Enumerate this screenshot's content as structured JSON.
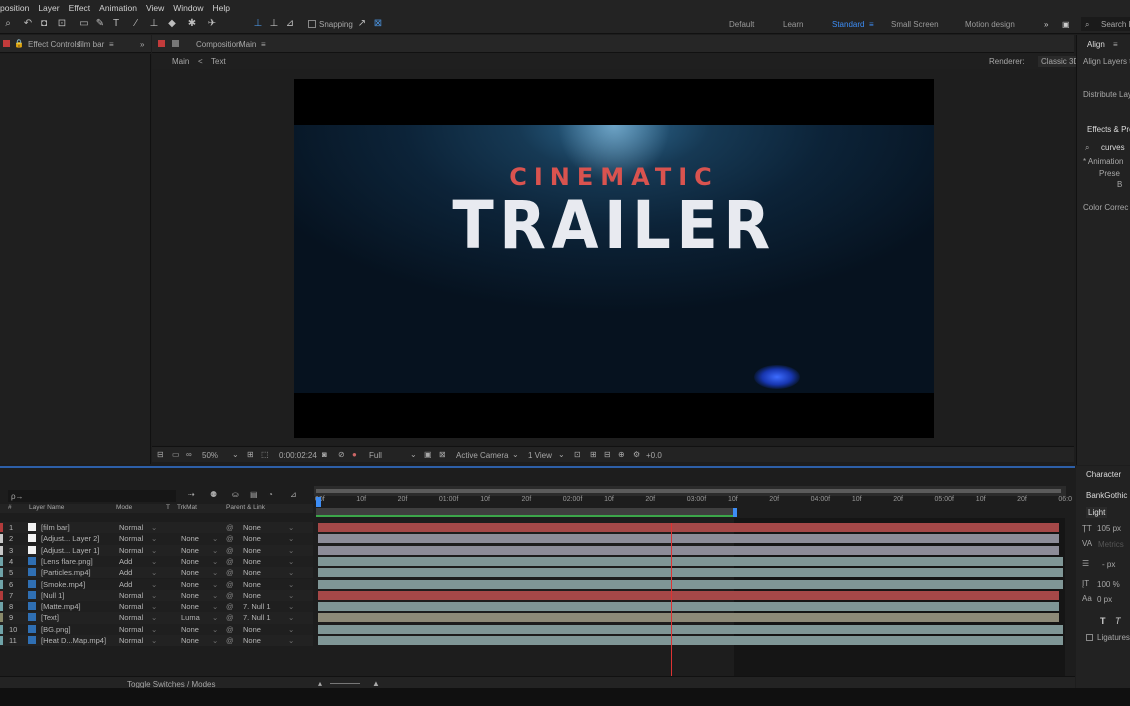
{
  "menu": [
    "position",
    "Layer",
    "Effect",
    "Animation",
    "View",
    "Window",
    "Help"
  ],
  "toolbar": {
    "snapping": "Snapping"
  },
  "workspaces": [
    {
      "label": "Default",
      "active": false
    },
    {
      "label": "Learn",
      "active": false
    },
    {
      "label": "Standard",
      "active": true
    },
    {
      "label": "Small Screen",
      "active": false
    },
    {
      "label": "Motion design",
      "active": false
    }
  ],
  "search_label": "Search H",
  "effect_controls": {
    "title": "Effect Controls",
    "layer": "film bar"
  },
  "composition": {
    "title": "Composition",
    "name": "Main",
    "tabs": [
      "Main",
      "Text"
    ],
    "renderer_label": "Renderer:",
    "renderer": "Classic 3D"
  },
  "right_panels": {
    "align": "Align",
    "align_layers": "Align Layers to",
    "distribute": "Distribute Laye",
    "effects_presets": "Effects & Pres",
    "search": "curves",
    "tree": [
      "* Animation",
      "Prese",
      "B",
      "Color Correc"
    ]
  },
  "preview": {
    "line1": "CINEMATIC",
    "line2": "TRAILER"
  },
  "viewer_bar": {
    "zoom": "50%",
    "timecode": "0:00:02:24",
    "quality": "Full",
    "camera": "Active Camera",
    "view": "1 View",
    "exposure": "+0.0"
  },
  "timeline": {
    "search_placeholder": "ρ→",
    "headers": {
      "num": "#",
      "name": "Layer Name",
      "mode": "Mode",
      "t": "T",
      "trkmat": "TrkMat",
      "parent": "Parent & Link"
    },
    "ruler": [
      "00f",
      "10f",
      "20f",
      "01:00f",
      "10f",
      "20f",
      "02:00f",
      "10f",
      "20f",
      "03:00f",
      "10f",
      "20f",
      "04:00f",
      "10f",
      "20f",
      "05:00f",
      "10f",
      "20f",
      "06:0"
    ],
    "layers": [
      {
        "num": "1",
        "name": "[film bar]",
        "mode": "Normal",
        "trkmat": "",
        "parent": "None",
        "color": "#b23b3b",
        "bar": "#a54848"
      },
      {
        "num": "2",
        "name": "[Adjust... Layer 2]",
        "mode": "Normal",
        "trkmat": "None",
        "parent": "None",
        "color": "#c8c8c8",
        "bar": "#8c8c98"
      },
      {
        "num": "3",
        "name": "[Adjust... Layer 1]",
        "mode": "Normal",
        "trkmat": "None",
        "parent": "None",
        "color": "#c8c8c8",
        "bar": "#8c8c98"
      },
      {
        "num": "4",
        "name": "[Lens flare.png]",
        "mode": "Add",
        "trkmat": "None",
        "parent": "None",
        "color": "#6fa3a8",
        "bar": "#7f9696"
      },
      {
        "num": "5",
        "name": "[Particles.mp4]",
        "mode": "Add",
        "trkmat": "None",
        "parent": "None",
        "color": "#6fa3a8",
        "bar": "#7f9696"
      },
      {
        "num": "6",
        "name": "[Smoke.mp4]",
        "mode": "Add",
        "trkmat": "None",
        "parent": "None",
        "color": "#6fa3a8",
        "bar": "#7f9696"
      },
      {
        "num": "7",
        "name": "[Null 1]",
        "mode": "Normal",
        "trkmat": "None",
        "parent": "None",
        "color": "#b23b3b",
        "bar": "#a54848"
      },
      {
        "num": "8",
        "name": "[Matte.mp4]",
        "mode": "Normal",
        "trkmat": "None",
        "parent": "7. Null 1",
        "color": "#6fa3a8",
        "bar": "#7f9696"
      },
      {
        "num": "9",
        "name": "[Text]",
        "mode": "Normal",
        "trkmat": "Luma",
        "parent": "7. Null 1",
        "color": "#8a8a6a",
        "bar": "#8d8a78"
      },
      {
        "num": "10",
        "name": "[BG.png]",
        "mode": "Normal",
        "trkmat": "None",
        "parent": "None",
        "color": "#6fa3a8",
        "bar": "#7f9696"
      },
      {
        "num": "11",
        "name": "[Heat D...Map.mp4]",
        "mode": "Normal",
        "trkmat": "None",
        "parent": "None",
        "color": "#6fa3a8",
        "bar": "#7f9696"
      }
    ],
    "toggle": "Toggle Switches / Modes"
  },
  "character": {
    "title": "Character",
    "font": "BankGothic L",
    "style": "Light",
    "size": "105 px",
    "tracking": "Metrics",
    "leading": "- px",
    "scale": "100 %",
    "baseline": "0 px",
    "ligatures": "Ligatures"
  }
}
